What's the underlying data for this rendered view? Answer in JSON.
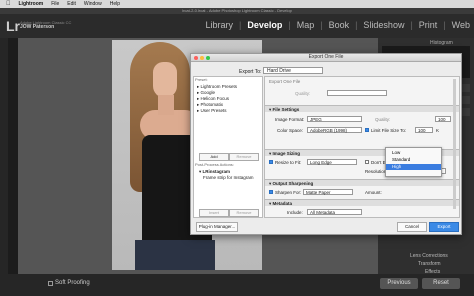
{
  "menubar": {
    "app": "Lightroom",
    "items": [
      "File",
      "Edit",
      "Window",
      "Help"
    ]
  },
  "window_title": "lrcat-2-0.lrcat - Adobe Photoshop Lightroom Classic - Develop",
  "lr": {
    "logo": "Lr",
    "line1": "Adobe Lightroom Classic CC",
    "line2": "JOW Paterson"
  },
  "modules": [
    "Library",
    "Develop",
    "Map",
    "Book",
    "Slideshow",
    "Print",
    "Web"
  ],
  "active_module": "Develop",
  "right_panel": {
    "histogram": "Histogram",
    "lens": "Lens Corrections",
    "transform": "Transform",
    "effects": "Effects"
  },
  "bottom": {
    "soft_proofing": "Soft Proofing",
    "previous": "Previous",
    "reset": "Reset"
  },
  "dialog": {
    "title": "Export One File",
    "export_to_label": "Export To:",
    "export_to_value": "Hard Drive",
    "preset_header": "Preset:",
    "presets": [
      "Lightroom Presets",
      "Google",
      "Helicon Focus",
      "Photomatix",
      "User Presets"
    ],
    "add": "Add",
    "remove": "Remove",
    "postproc_header": "Post-Process Actions:",
    "postproc_item1": "LRinstagram",
    "postproc_item2": "Frame strip for Instagram",
    "insert": "Insert",
    "remove2": "Remove",
    "export_one_file": "Export One File",
    "quality_label": "Quality:",
    "file_settings": {
      "header": "File Settings",
      "image_format_label": "Image Format:",
      "image_format": "JPEG",
      "quality_label": "Quality:",
      "quality_value": "100",
      "color_space_label": "Color Space:",
      "color_space": "AdobeRGB (1998)",
      "limit_label": "Limit File Size To:",
      "limit_value": "100",
      "limit_unit": "K"
    },
    "image_sizing": {
      "header": "Image Sizing",
      "resize_label": "Resize to Fit:",
      "resize_value": "Long Edge",
      "dont_enlarge": "Don't Enlarge",
      "resolution_label": "Resolution:",
      "resolution_value": "300",
      "resolution_unit": "pixels per inch"
    },
    "output_sharpening": {
      "header": "Output Sharpening",
      "sharpen_label": "Sharpen For:",
      "sharpen_value": "Matte Paper",
      "amount_label": "Amount:"
    },
    "metadata": {
      "header": "Metadata",
      "include_label": "Include:",
      "include_value": "All Metadata"
    },
    "dropdown_options": [
      "Low",
      "Standard",
      "High"
    ],
    "dropdown_selected": "High",
    "plugin_manager": "Plug-in Manager...",
    "cancel": "Cancel",
    "export": "Export"
  }
}
